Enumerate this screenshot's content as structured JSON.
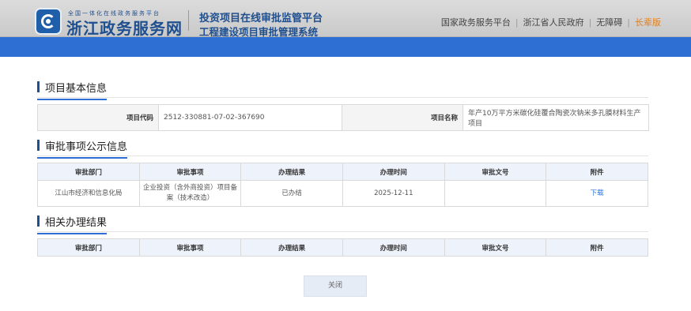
{
  "header": {
    "logo_small": "全国一体化在线政务服务平台",
    "logo_title": "浙江政务服务网",
    "system_title_1": "投资项目在线审批监管平台",
    "system_title_2": "工程建设项目审批管理系统",
    "links": [
      "国家政务服务平台",
      "浙江省人民政府",
      "无障碍",
      "长辈版"
    ],
    "link_separator": "|"
  },
  "project_info": {
    "section_title": "项目基本信息",
    "code_label": "项目代码",
    "code_value": "2512-330881-07-02-367690",
    "name_label": "项目名称",
    "name_value": "年产10万平方米碳化硅覆合陶瓷次钠米多孔膜材料生产项目"
  },
  "approval_publicity": {
    "section_title": "审批事项公示信息",
    "columns": [
      "审批部门",
      "审批事项",
      "办理结果",
      "办理时间",
      "审批文号",
      "附件"
    ],
    "rows": [
      {
        "department": "江山市经济和信息化局",
        "item": "企业投资（含外商投资）项目备案（技术改造）",
        "result": "已办结",
        "time": "2025-12-11",
        "doc_no": "",
        "attachment": "下载"
      }
    ]
  },
  "related_results": {
    "section_title": "相关办理结果",
    "columns": [
      "审批部门",
      "审批事项",
      "办理结果",
      "办理时间",
      "审批文号",
      "附件"
    ]
  },
  "close_button": "关闭",
  "colors": {
    "accent": "#2d6fd3",
    "brand": "#1f4f8f",
    "elder_link": "#d9822b"
  }
}
